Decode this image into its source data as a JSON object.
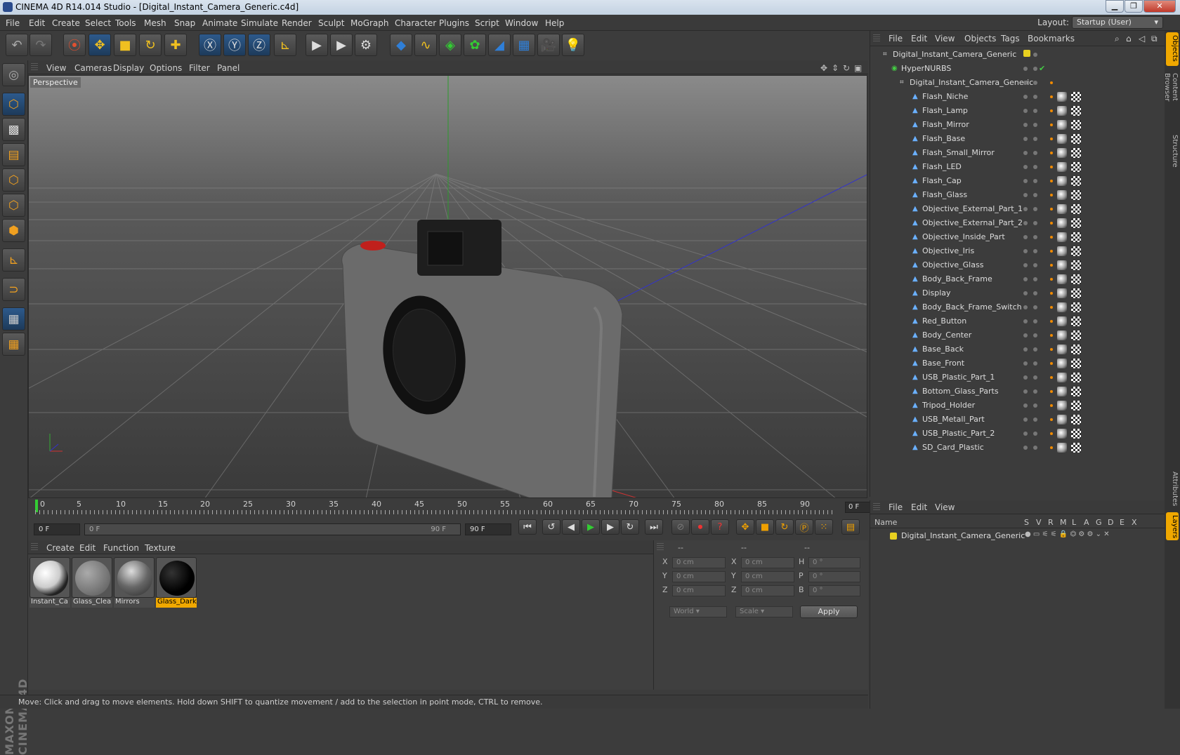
{
  "window": {
    "title": "CINEMA 4D R14.014 Studio - [Digital_Instant_Camera_Generic.c4d]"
  },
  "menu": [
    "File",
    "Edit",
    "Create",
    "Select",
    "Tools",
    "Mesh",
    "Snap",
    "Animate",
    "Simulate",
    "Render",
    "Sculpt",
    "MoGraph",
    "Character",
    "Plugins",
    "Script",
    "Window",
    "Help"
  ],
  "layout": {
    "label": "Layout:",
    "value": "Startup (User)"
  },
  "viewport": {
    "menu": [
      "View",
      "Cameras",
      "Display",
      "Options",
      "Filter",
      "Panel"
    ],
    "label": "Perspective"
  },
  "timeline": {
    "ticks": [
      "0",
      "5",
      "10",
      "15",
      "20",
      "25",
      "30",
      "35",
      "40",
      "45",
      "50",
      "55",
      "60",
      "65",
      "70",
      "75",
      "80",
      "85",
      "90"
    ],
    "end_field": "0 F"
  },
  "transport": {
    "current_frame": "0 F",
    "range_start": "0 F",
    "range_end": "90 F",
    "max_frame": "90 F"
  },
  "materials": {
    "menu": [
      "Create",
      "Edit",
      "Function",
      "Texture"
    ],
    "items": [
      "Instant_Ca",
      "Glass_Clea",
      "Mirrors",
      "Glass_Dark"
    ]
  },
  "coords": {
    "headers": [
      "--",
      "--",
      "--"
    ],
    "rows": [
      {
        "a": "X",
        "av": "0 cm",
        "b": "X",
        "bv": "0 cm",
        "c": "H",
        "cv": "0 °"
      },
      {
        "a": "Y",
        "av": "0 cm",
        "b": "Y",
        "bv": "0 cm",
        "c": "P",
        "cv": "0 °"
      },
      {
        "a": "Z",
        "av": "0 cm",
        "b": "Z",
        "bv": "0 cm",
        "c": "B",
        "cv": "0 °"
      }
    ],
    "world": "World",
    "scale": "Scale",
    "apply": "Apply"
  },
  "status": "Move: Click and drag to move elements. Hold down SHIFT to quantize movement / add to the selection in point mode, CTRL to remove.",
  "objects": {
    "menu": [
      "File",
      "Edit",
      "View",
      "Objects",
      "Tags",
      "Bookmarks"
    ],
    "root": "Digital_Instant_Camera_Generic",
    "hypernurbs": "HyperNURBS",
    "group": "Digital_Instant_Camera_Generic",
    "children": [
      "Flash_Niche",
      "Flash_Lamp",
      "Flash_Mirror",
      "Flash_Base",
      "Flash_Small_Mirror",
      "Flash_LED",
      "Flash_Cap",
      "Flash_Glass",
      "Objective_External_Part_1",
      "Objective_External_Part_2",
      "Objective_Inside_Part",
      "Objective_Iris",
      "Objective_Glass",
      "Body_Back_Frame",
      "Display",
      "Body_Back_Frame_Switch",
      "Red_Button",
      "Body_Center",
      "Base_Back",
      "Base_Front",
      "USB_Plastic_Part_1",
      "Bottom_Glass_Parts",
      "Tripod_Holder",
      "USB_Metall_Part",
      "USB_Plastic_Part_2",
      "SD_Card_Plastic"
    ]
  },
  "layers": {
    "menu": [
      "File",
      "Edit",
      "View"
    ],
    "columns": {
      "name": "Name",
      "flags": [
        "S",
        "V",
        "R",
        "M",
        "L",
        "A",
        "G",
        "D",
        "E",
        "X"
      ]
    },
    "row": "Digital_Instant_Camera_Generic"
  },
  "side_tabs": [
    "Objects",
    "Content Browser",
    "Structure",
    "Attributes",
    "Layers"
  ],
  "brand": "MAXON CINEMA 4D",
  "colors": {
    "accent": "#f0a800",
    "x_axis": "#cc3333",
    "y_axis": "#33aa33",
    "z_axis": "#3333cc"
  }
}
